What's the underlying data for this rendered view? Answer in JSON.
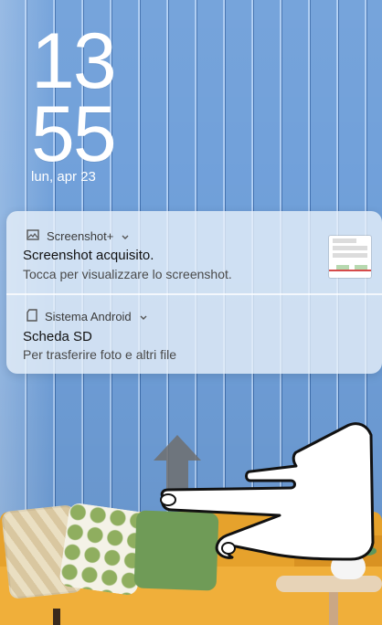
{
  "lockscreen": {
    "clock_hours": "13",
    "clock_minutes": "55",
    "date": "lun, apr 23"
  },
  "notifications": [
    {
      "app": "Screenshot+",
      "app_icon": "image-icon",
      "title": "Screenshot acquisito.",
      "text": "Tocca per visualizzare lo screenshot.",
      "has_thumbnail": true
    },
    {
      "app": "Sistema Android",
      "app_icon": "sd-card-icon",
      "title": "Scheda SD",
      "text": "Per trasferire foto e altri file"
    }
  ],
  "gesture_hint": {
    "arrow_icon": "swipe-up-arrow-icon",
    "hand_icon": "hand-pointer-icon"
  },
  "colors": {
    "wallpaper_blue": "#6f9fd9",
    "sofa_yellow": "#f0af3a",
    "notification_bg": "rgba(235,242,250,0.78)"
  }
}
